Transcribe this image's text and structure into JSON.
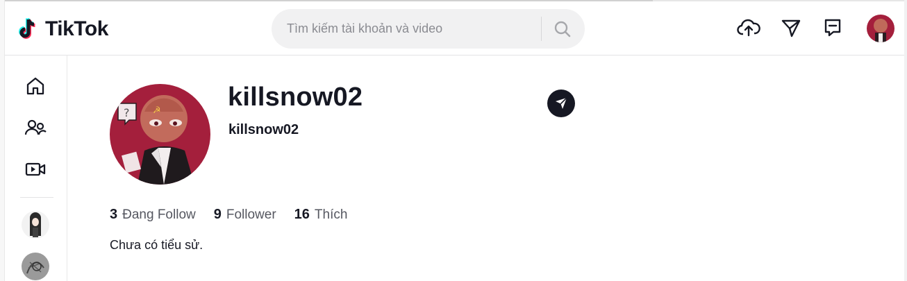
{
  "header": {
    "logo_text": "TikTok",
    "search": {
      "placeholder": "Tìm kiếm tài khoản và video"
    },
    "icons": [
      "upload-cloud-icon",
      "send-icon",
      "inbox-message-icon",
      "avatar"
    ]
  },
  "sidebar": {
    "items": [
      "home-icon",
      "following-users-icon",
      "live-video-icon"
    ],
    "following_accounts": 2
  },
  "profile": {
    "title": "killsnow02",
    "subtitle": "killsnow02",
    "stats": [
      {
        "value": "3",
        "label": "Đang Follow"
      },
      {
        "value": "9",
        "label": "Follower"
      },
      {
        "value": "16",
        "label": "Thích"
      }
    ],
    "bio": "Chưa có tiểu sử."
  },
  "colors": {
    "text": "#161823",
    "muted": "#555760",
    "search_bg": "#f1f1f2",
    "tiktok_cyan": "#25f4ee",
    "tiktok_red": "#fe2c55",
    "avatar_bg": "#a41f3c"
  }
}
